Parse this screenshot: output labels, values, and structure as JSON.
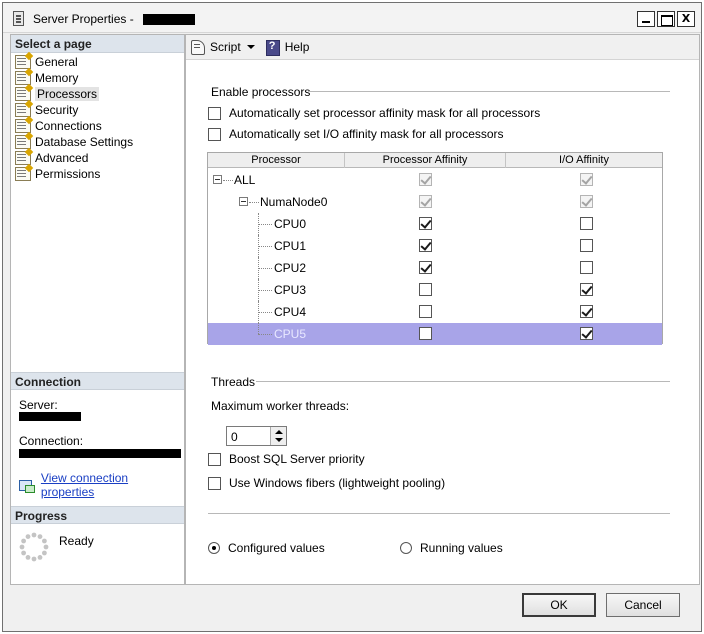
{
  "window": {
    "title": "Server Properties -",
    "controls": {
      "minimize": "_",
      "maximize": "□",
      "close": "X"
    }
  },
  "left_pane": {
    "select_page_header": "Select a page",
    "pages": [
      {
        "label": "General",
        "icon": "wrench-page-icon",
        "selected": false
      },
      {
        "label": "Memory",
        "icon": "wrench-page-icon",
        "selected": false
      },
      {
        "label": "Processors",
        "icon": "wrench-page-icon",
        "selected": true
      },
      {
        "label": "Security",
        "icon": "wrench-page-icon",
        "selected": false
      },
      {
        "label": "Connections",
        "icon": "wrench-page-icon",
        "selected": false
      },
      {
        "label": "Database Settings",
        "icon": "wrench-page-icon",
        "selected": false
      },
      {
        "label": "Advanced",
        "icon": "wrench-page-icon",
        "selected": false
      },
      {
        "label": "Permissions",
        "icon": "wrench-page-icon",
        "selected": false
      }
    ],
    "connection": {
      "header": "Connection",
      "server_label": "Server:",
      "connection_label": "Connection:",
      "view_link": "View connection properties"
    },
    "progress": {
      "header": "Progress",
      "status": "Ready"
    }
  },
  "toolbar": {
    "script_label": "Script",
    "help_label": "Help"
  },
  "enable_processors": {
    "title": "Enable processors",
    "auto_processor_affinity": {
      "label": "Automatically set processor affinity mask for all processors",
      "checked": false
    },
    "auto_io_affinity": {
      "label": "Automatically set I/O affinity mask for all processors",
      "checked": false
    }
  },
  "processor_grid": {
    "columns": [
      "Processor",
      "Processor Affinity",
      "I/O Affinity"
    ],
    "rows": [
      {
        "name": "ALL",
        "level": 0,
        "affinity": true,
        "io": true,
        "disabled": true,
        "expandable": true,
        "selected": false
      },
      {
        "name": "NumaNode0",
        "level": 1,
        "affinity": true,
        "io": true,
        "disabled": true,
        "expandable": true,
        "selected": false
      },
      {
        "name": "CPU0",
        "level": 2,
        "affinity": true,
        "io": false,
        "disabled": false,
        "expandable": false,
        "selected": false
      },
      {
        "name": "CPU1",
        "level": 2,
        "affinity": true,
        "io": false,
        "disabled": false,
        "expandable": false,
        "selected": false
      },
      {
        "name": "CPU2",
        "level": 2,
        "affinity": true,
        "io": false,
        "disabled": false,
        "expandable": false,
        "selected": false
      },
      {
        "name": "CPU3",
        "level": 2,
        "affinity": false,
        "io": true,
        "disabled": false,
        "expandable": false,
        "selected": false
      },
      {
        "name": "CPU4",
        "level": 2,
        "affinity": false,
        "io": true,
        "disabled": false,
        "expandable": false,
        "selected": false
      },
      {
        "name": "CPU5",
        "level": 2,
        "affinity": false,
        "io": true,
        "disabled": false,
        "expandable": false,
        "selected": true
      }
    ]
  },
  "threads": {
    "title": "Threads",
    "max_worker_label": "Maximum worker threads:",
    "max_worker_value": "0",
    "boost_priority": {
      "label": "Boost SQL Server priority",
      "checked": false
    },
    "windows_fibers": {
      "label": "Use Windows fibers (lightweight pooling)",
      "checked": false
    }
  },
  "values_mode": {
    "configured_label": "Configured  values",
    "running_label": "Running values",
    "selected": "configured"
  },
  "buttons": {
    "ok": "OK",
    "cancel": "Cancel"
  }
}
